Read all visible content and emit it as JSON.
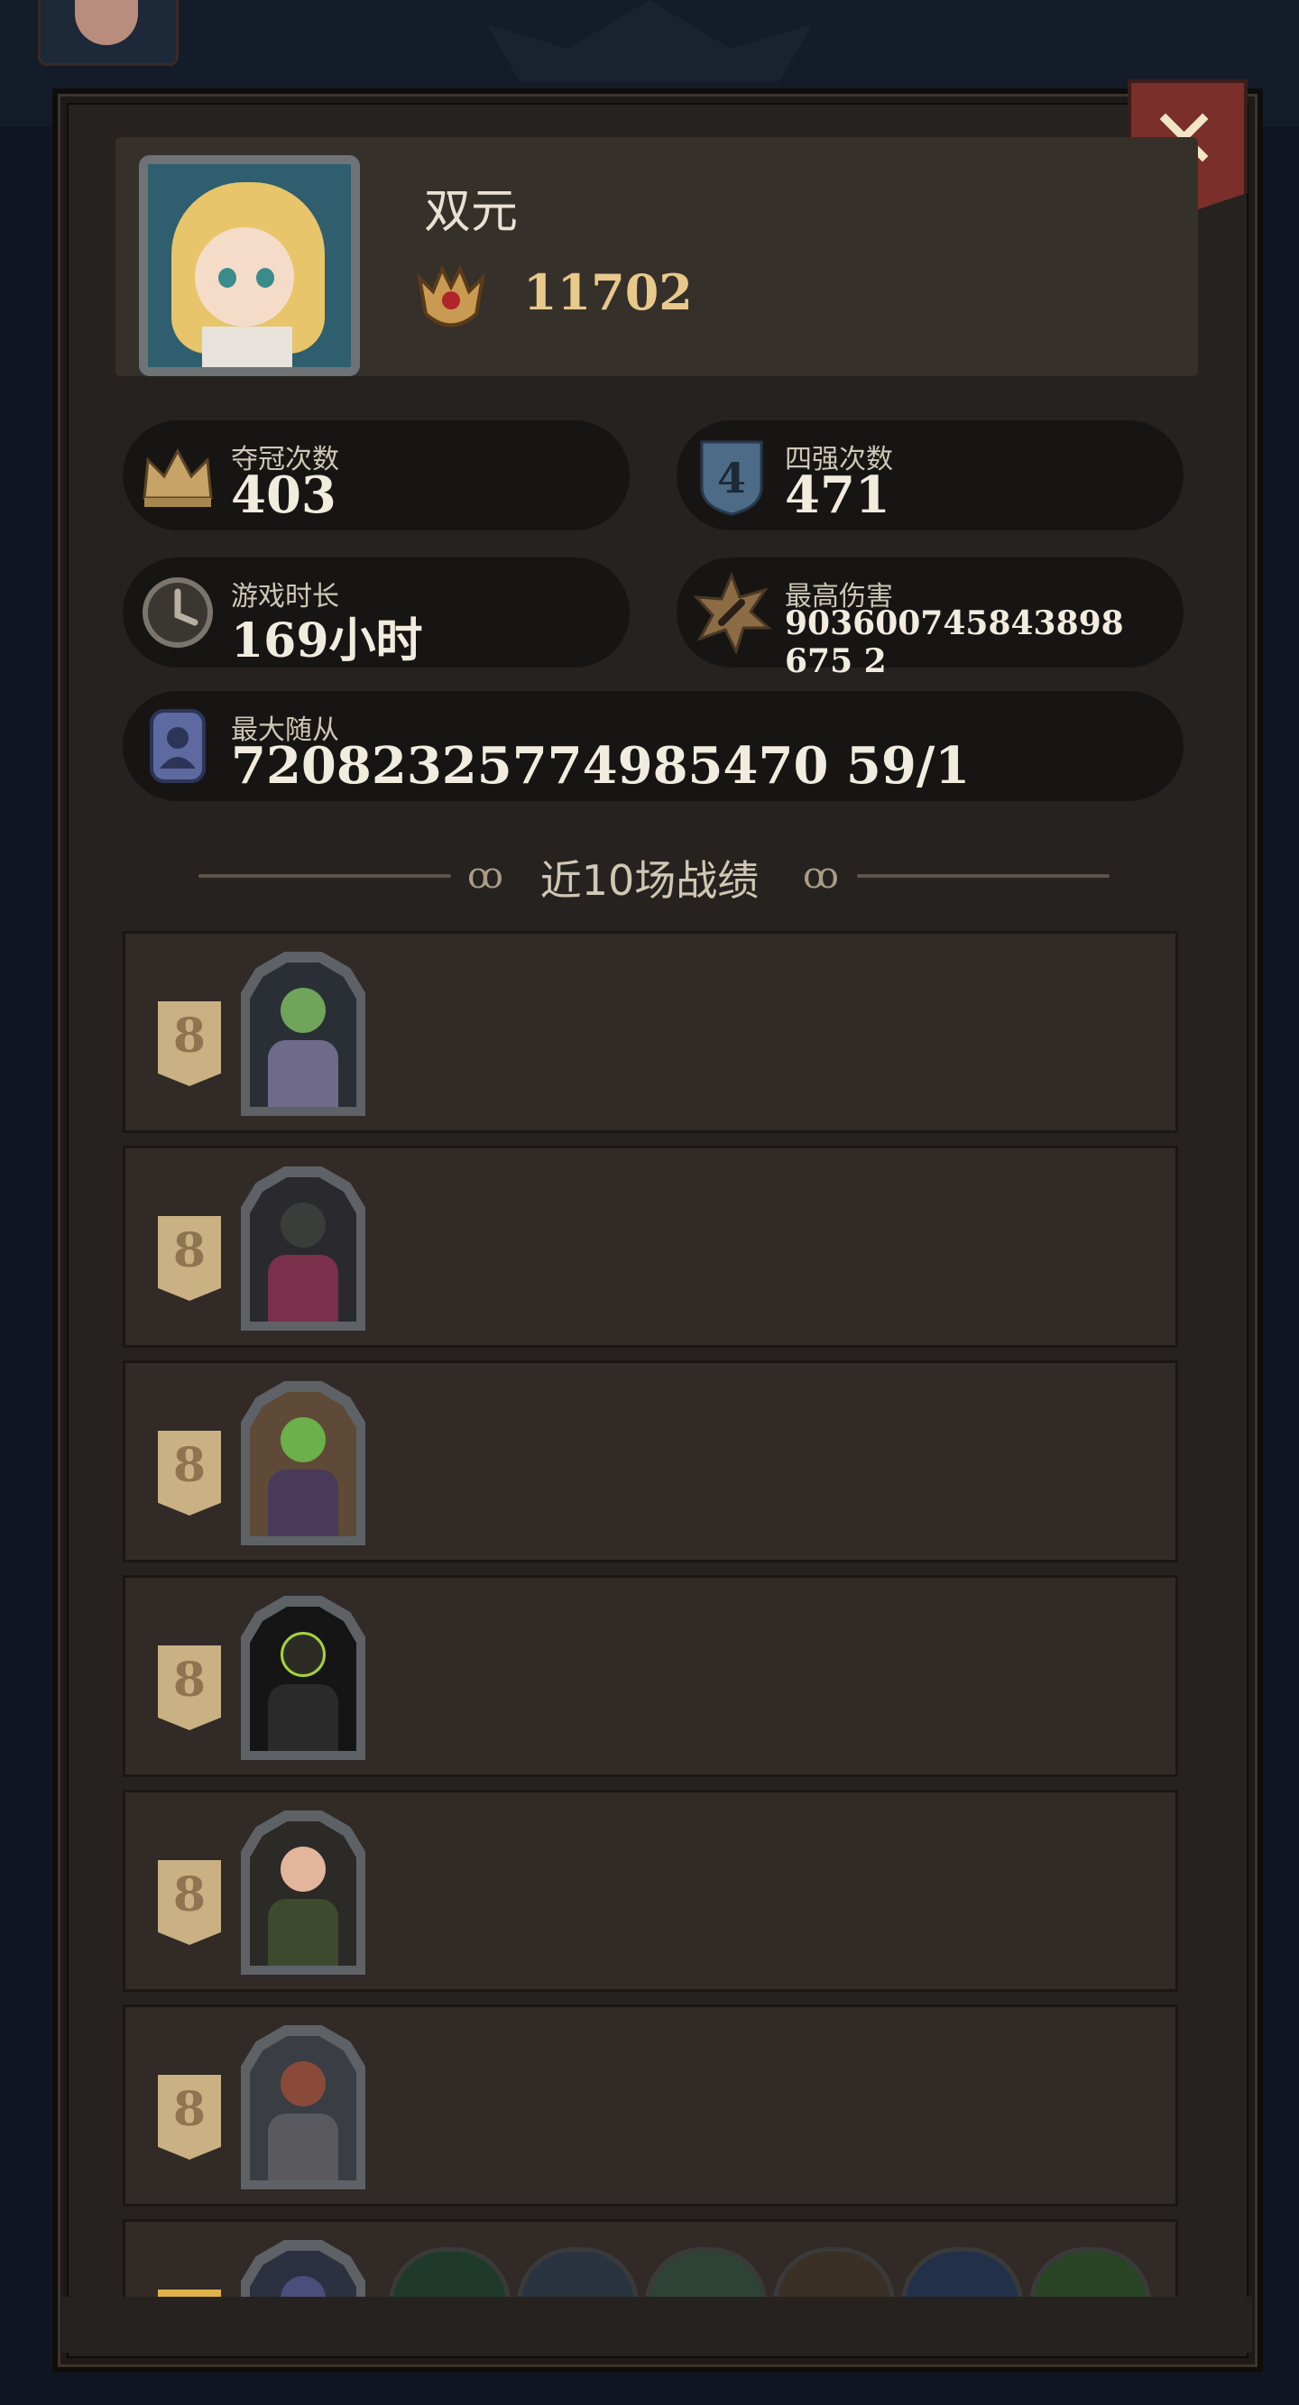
{
  "close": {
    "label": "✕"
  },
  "player": {
    "name": "双元",
    "trophies": "11702"
  },
  "stats": {
    "champion": {
      "label": "夺冠次数",
      "value": "403"
    },
    "top4": {
      "label": "四强次数",
      "value": "471",
      "icon_text": "4"
    },
    "playtime": {
      "label": "游戏时长",
      "value": "169小时"
    },
    "max_damage": {
      "label": "最高伤害",
      "value": "903600745843898675 2"
    },
    "max_follower": {
      "label": "最大随从",
      "value": "72082325774985470 59/1"
    }
  },
  "section": {
    "title": "近10场战绩"
  },
  "records": [
    {
      "rank": "8",
      "hero": "hero-green-witch"
    },
    {
      "rank": "8",
      "hero": "hero-horned-cat"
    },
    {
      "rank": "8",
      "hero": "hero-plant-beast"
    },
    {
      "rank": "8",
      "hero": "hero-shadow-demon"
    },
    {
      "rank": "8",
      "hero": "hero-red-witch"
    },
    {
      "rank": "8",
      "hero": "hero-deer-knight"
    },
    {
      "rank": "",
      "hero": "hero-partial"
    }
  ],
  "colors": {
    "accent_gold": "#e8c88b",
    "rank_badge": "#c9b183",
    "close_red": "#7a2f2a"
  }
}
